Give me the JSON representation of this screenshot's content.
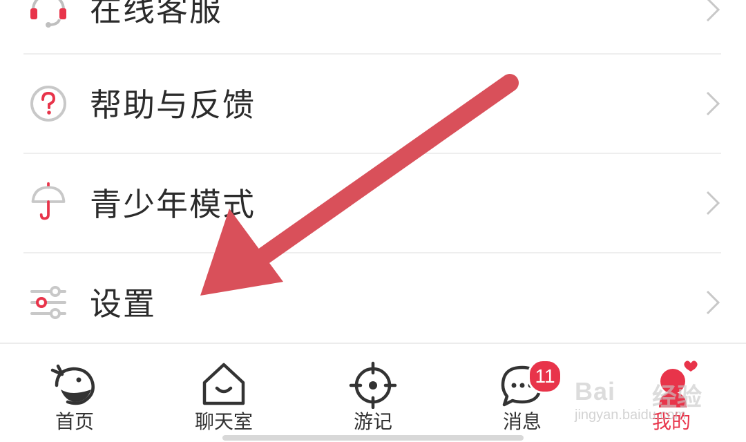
{
  "menu": {
    "items": [
      {
        "label": "在线客服",
        "icon": "headset-icon"
      },
      {
        "label": "帮助与反馈",
        "icon": "question-circle-icon"
      },
      {
        "label": "青少年模式",
        "icon": "umbrella-icon"
      },
      {
        "label": "设置",
        "icon": "sliders-icon"
      }
    ]
  },
  "tabbar": {
    "tabs": [
      {
        "label": "首页",
        "icon": "bird-home-icon"
      },
      {
        "label": "聊天室",
        "icon": "house-smile-icon"
      },
      {
        "label": "游记",
        "icon": "target-icon"
      },
      {
        "label": "消息",
        "icon": "chat-bubble-icon",
        "badge": "11"
      },
      {
        "label": "我的",
        "icon": "profile-icon",
        "active": true
      }
    ]
  },
  "watermark": {
    "logo": "Bai",
    "logo_cn": "经验",
    "url": "jingyan.baidu.com"
  },
  "colors": {
    "accent": "#e8344a",
    "arrow": "#d9505a",
    "divider": "#eeeeee",
    "text": "#2b2b2b"
  }
}
